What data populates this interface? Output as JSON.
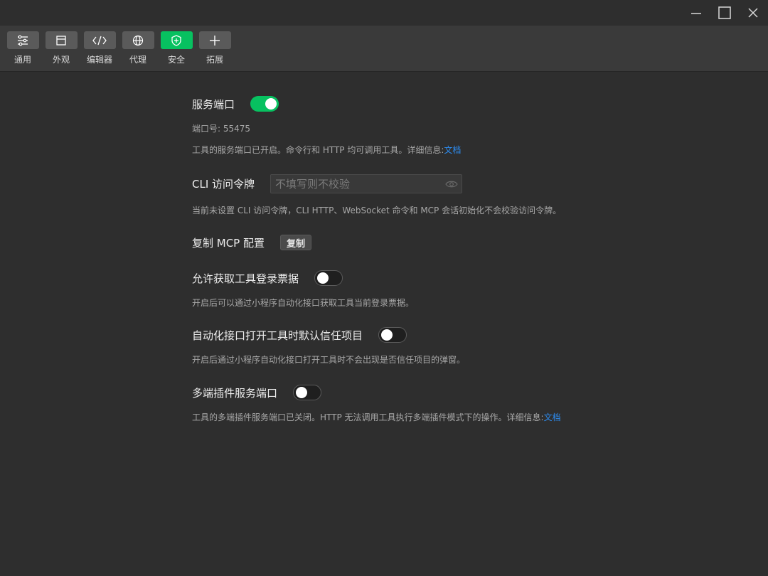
{
  "window": {
    "controls": [
      "minimize-icon",
      "maximize-icon",
      "close-icon"
    ]
  },
  "toolbar": {
    "tabs": [
      {
        "label": "通用",
        "icon": "sliders-icon"
      },
      {
        "label": "外观",
        "icon": "window-icon"
      },
      {
        "label": "编辑器",
        "icon": "code-icon"
      },
      {
        "label": "代理",
        "icon": "globe-icon"
      },
      {
        "label": "安全",
        "icon": "shield-icon",
        "active": true
      },
      {
        "label": "拓展",
        "icon": "plus-icon"
      }
    ]
  },
  "service_port": {
    "title": "服务端口",
    "enabled": true,
    "port_label": "端口号: 55475",
    "desc": "工具的服务端口已开启。命令行和 HTTP 均可调用工具。详细信息:",
    "link": "文档"
  },
  "cli_token": {
    "title": "CLI 访问令牌",
    "value": "",
    "placeholder": "不填写则不校验",
    "desc": "当前未设置 CLI 访问令牌，CLI HTTP、WebSocket 命令和 MCP 会话初始化不会校验访问令牌。"
  },
  "mcp_config": {
    "title": "复制 MCP 配置",
    "button": "复制"
  },
  "login_ticket": {
    "title": "允许获取工具登录票据",
    "enabled": false,
    "desc": "开启后可以通过小程序自动化接口获取工具当前登录票据。"
  },
  "trust_project": {
    "title": "自动化接口打开工具时默认信任项目",
    "enabled": false,
    "desc": "开启后通过小程序自动化接口打开工具时不会出现是否信任项目的弹窗。"
  },
  "multi_port": {
    "title": "多端插件服务端口",
    "enabled": false,
    "desc": "工具的多端插件服务端口已关闭。HTTP 无法调用工具执行多端插件模式下的操作。详细信息:",
    "link": "文档"
  },
  "colors": {
    "accent": "#07c160",
    "link": "#2d8cf0",
    "background": "#2e2e2e",
    "toolbar": "#3a3a3a"
  }
}
